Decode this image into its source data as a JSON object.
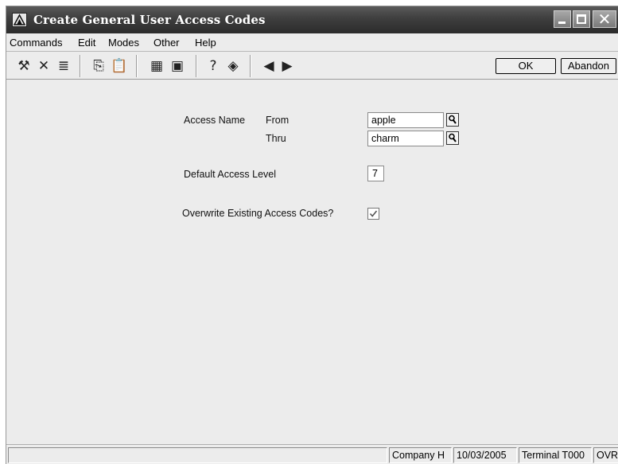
{
  "window": {
    "title": "Create General User Access Codes",
    "controls": {
      "minimize": "",
      "maximize": "",
      "close": "✕"
    }
  },
  "menu": [
    "Commands",
    "Edit",
    "Modes",
    "Other",
    "Help"
  ],
  "toolbar": {
    "icons": [
      {
        "name": "tools-icon",
        "glyph": "⚒"
      },
      {
        "name": "delete-x-icon",
        "glyph": "✕"
      },
      {
        "name": "list-icon",
        "glyph": "≣"
      },
      {
        "name": "copy-icon",
        "glyph": "⎘"
      },
      {
        "name": "paste-icon",
        "glyph": "📋"
      },
      {
        "name": "calculator-icon",
        "glyph": "▦"
      },
      {
        "name": "calendar-icon",
        "glyph": "▣"
      },
      {
        "name": "help-icon",
        "glyph": "?"
      },
      {
        "name": "book-icon",
        "glyph": "◈"
      },
      {
        "name": "back-icon",
        "glyph": "◀"
      },
      {
        "name": "forward-icon",
        "glyph": "▶"
      }
    ],
    "ok_label": "OK",
    "abandon_label": "Abandon"
  },
  "form": {
    "access_name_label": "Access Name",
    "from_label": "From",
    "thru_label": "Thru",
    "from_value": "apple",
    "thru_value": "charm",
    "default_access_level_label": "Default Access Level",
    "default_access_level_value": "7",
    "overwrite_label": "Overwrite Existing Access Codes?",
    "overwrite_checked": true
  },
  "status": {
    "company": "Company H",
    "date": "10/03/2005",
    "terminal": "Terminal T000",
    "mode": "OVR"
  }
}
